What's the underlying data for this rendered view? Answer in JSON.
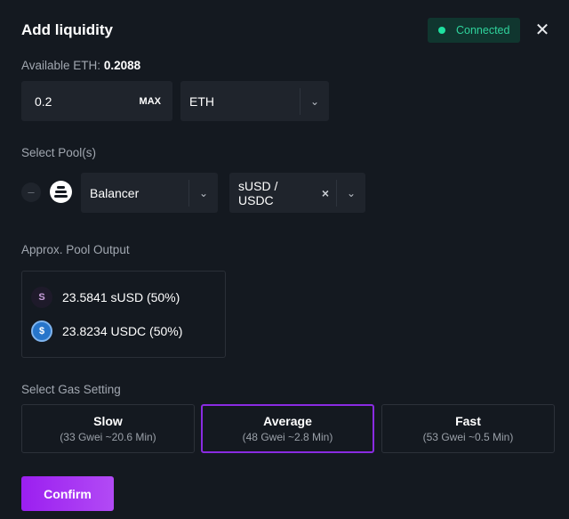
{
  "header": {
    "title": "Add liquidity",
    "status": "Connected",
    "status_color": "#2fd39c"
  },
  "amount": {
    "label": "Available ETH:",
    "available": "0.2088",
    "value": "0.2",
    "max_label": "MAX",
    "token": "ETH"
  },
  "pools": {
    "label": "Select Pool(s)",
    "remove": "–",
    "protocol": "Balancer",
    "pair": "sUSD / USDC",
    "clear": "×"
  },
  "output": {
    "label": "Approx. Pool Output",
    "items": [
      {
        "icon": "susd-icon",
        "glyph": "S",
        "text": "23.5841 sUSD (50%)"
      },
      {
        "icon": "usdc-icon",
        "glyph": "$",
        "text": "23.8234 USDC (50%)"
      }
    ]
  },
  "gas": {
    "label": "Select Gas Setting",
    "selected": "Average",
    "options": [
      {
        "name": "Slow",
        "detail": "(33 Gwei ~20.6 Min)"
      },
      {
        "name": "Average",
        "detail": "(48 Gwei ~2.8 Min)"
      },
      {
        "name": "Fast",
        "detail": "(53 Gwei ~0.5 Min)"
      }
    ]
  },
  "confirm_label": "Confirm",
  "accent": "#8a2be2"
}
